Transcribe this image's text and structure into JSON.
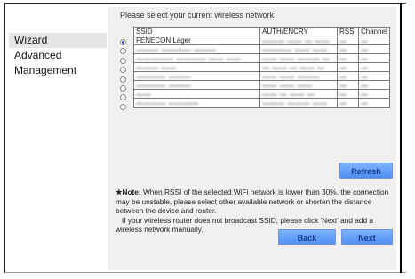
{
  "sidebar": {
    "items": [
      {
        "label": "Wizard",
        "active": true
      },
      {
        "label": "Advanced",
        "active": false
      },
      {
        "label": "Management",
        "active": false
      }
    ]
  },
  "main": {
    "heading": "Please select your current wireless network:",
    "table": {
      "columns": [
        "SSID",
        "AUTH/ENCRY",
        "RSSI",
        "Channel"
      ],
      "rows": [
        {
          "selected": true,
          "ssid": "FENECON Lager",
          "auth": "",
          "rssi": "",
          "channel": ""
        },
        {
          "selected": false,
          "ssid": "",
          "auth": "",
          "rssi": "",
          "channel": ""
        },
        {
          "selected": false,
          "ssid": "",
          "auth": "",
          "rssi": "",
          "channel": ""
        },
        {
          "selected": false,
          "ssid": "",
          "auth": "",
          "rssi": "",
          "channel": ""
        },
        {
          "selected": false,
          "ssid": "",
          "auth": "",
          "rssi": "",
          "channel": ""
        },
        {
          "selected": false,
          "ssid": "",
          "auth": "",
          "rssi": "",
          "channel": ""
        },
        {
          "selected": false,
          "ssid": "",
          "auth": "",
          "rssi": "",
          "channel": ""
        },
        {
          "selected": false,
          "ssid": "",
          "auth": "",
          "rssi": "",
          "channel": ""
        }
      ]
    },
    "refresh_label": "Refresh",
    "note": {
      "star": "★",
      "label": "Note:",
      "text1": " When RSSI of the selected WiFi network is lower than 30%, the connection may be unstable, please select other available network or shorten the distance between the device and router.",
      "text2": "If your wireless router does not broadcast SSID, please click 'Next' and add a wireless network manually."
    },
    "back_label": "Back",
    "next_label": "Next"
  },
  "colors": {
    "button_top": "#7db4ff",
    "button_bottom": "#4f8df0",
    "button_text": "#103a8c",
    "panel_bg": "#f0f0f0",
    "radio_selected": "#2a3fd6"
  }
}
